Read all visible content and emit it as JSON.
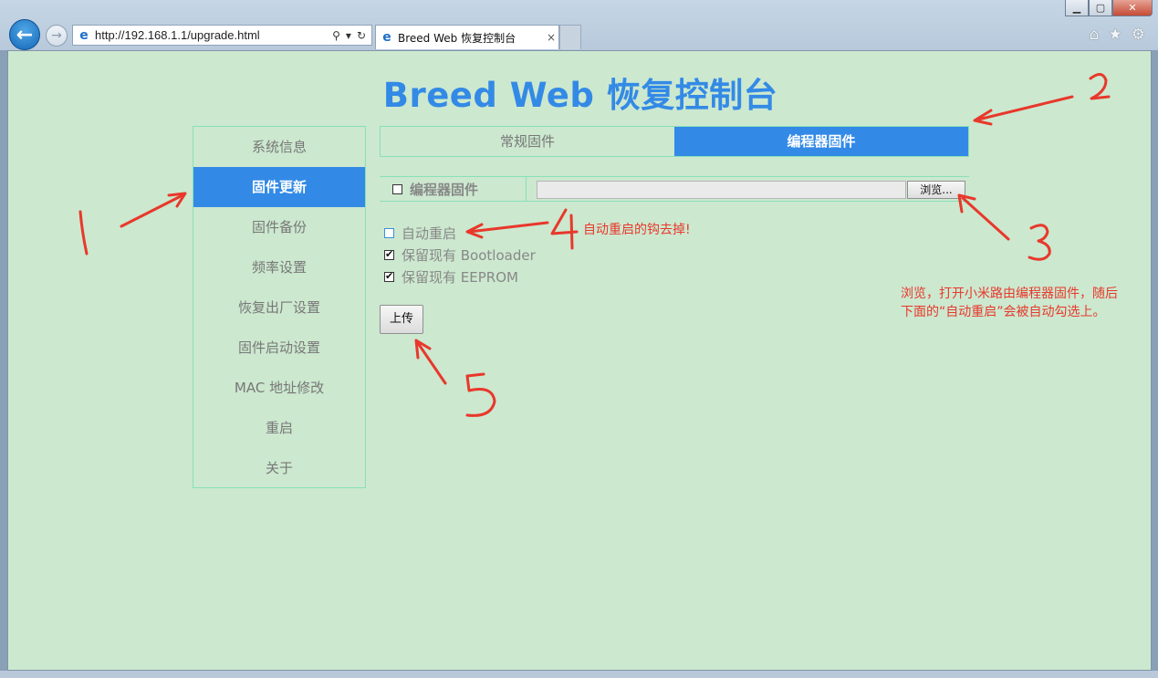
{
  "browser": {
    "url": "http://192.168.1.1/upgrade.html",
    "tab_title": "Breed Web 恢复控制台",
    "close_tab": "×"
  },
  "page": {
    "title": "Breed Web 恢复控制台"
  },
  "sidebar": {
    "items": [
      {
        "label": "系统信息",
        "active": false
      },
      {
        "label": "固件更新",
        "active": true
      },
      {
        "label": "固件备份",
        "active": false
      },
      {
        "label": "频率设置",
        "active": false
      },
      {
        "label": "恢复出厂设置",
        "active": false
      },
      {
        "label": "固件启动设置",
        "active": false
      },
      {
        "label": "MAC 地址修改",
        "active": false
      },
      {
        "label": "重启",
        "active": false
      },
      {
        "label": "关于",
        "active": false
      }
    ]
  },
  "tabs": [
    {
      "label": "常规固件",
      "active": false
    },
    {
      "label": "编程器固件",
      "active": true
    }
  ],
  "firmware": {
    "label": "编程器固件",
    "checked": false,
    "browse_label": "浏览..."
  },
  "options": [
    {
      "label": "自动重启",
      "checked": false
    },
    {
      "label": "保留现有 Bootloader",
      "checked": true
    },
    {
      "label": "保留现有 EEPROM",
      "checked": true
    }
  ],
  "upload_label": "上传",
  "annotations": {
    "note4": "自动重启的钩去掉!",
    "note3_line1": "浏览，打开小米路由编程器固件，随后",
    "note3_line2": "下面的“自动重启”会被自动勾选上。"
  },
  "colors": {
    "accent": "#338ae6",
    "page_bg": "#cce8cf",
    "border": "#88e0b7",
    "annotation": "#e8382b"
  }
}
